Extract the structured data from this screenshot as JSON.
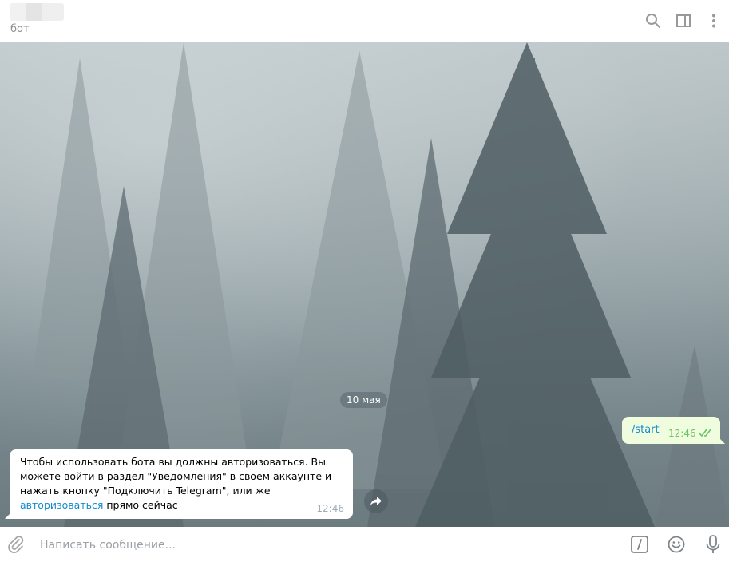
{
  "header": {
    "status": "бот",
    "icons": [
      "search-icon",
      "sidebar-toggle-icon",
      "more-vertical-icon"
    ]
  },
  "chat": {
    "date_badge": "10 мая",
    "outgoing": {
      "text": "/start",
      "time": "12:46",
      "status_icon": "double-check-icon"
    },
    "incoming": {
      "text_before_link": "Чтобы использовать бота вы должны авторизоваться. Вы можете войти в раздел \"Уведомления\" в своем аккаунте и нажать кнопку \"Подключить Telegram\", или же ",
      "link_text": "авторизоваться",
      "text_after_link": " прямо сейчас",
      "time": "12:46"
    },
    "forward_icon": "forward-arrow-icon"
  },
  "composer": {
    "placeholder": "Написать сообщение...",
    "icons": [
      "paperclip-icon",
      "bot-command-icon",
      "emoji-icon",
      "microphone-icon"
    ]
  },
  "colors": {
    "accent": "#168acd",
    "outgoing_bubble": "#effdde",
    "outgoing_time": "#6cc264"
  }
}
